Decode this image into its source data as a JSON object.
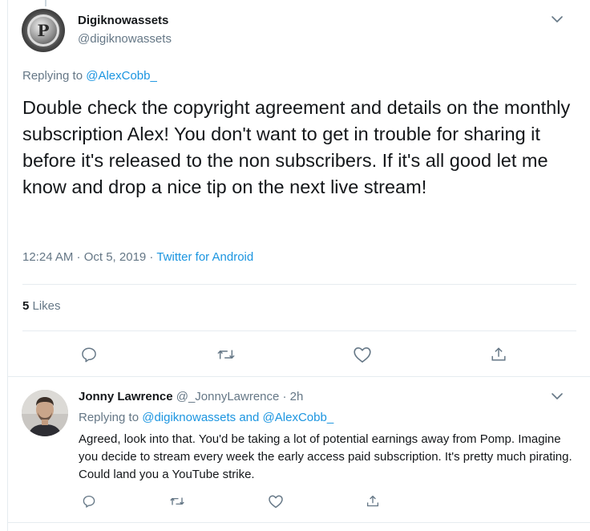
{
  "main_tweet": {
    "author_name": "Digiknowassets",
    "author_handle": "@digiknowassets",
    "replying_prefix": "Replying to",
    "replying_to": "@AlexCobb_",
    "text": "Double check the copyright agreement and details on the monthly subscription Alex! You don't want to get in trouble for sharing it before it's released to the non subscribers. If it's all good let me know and drop a nice tip on the next live stream!",
    "timestamp": "12:24 AM · Oct 5, 2019 · ",
    "source": "Twitter for Android",
    "likes_count": "5",
    "likes_label": " Likes",
    "avatar_letter": "P"
  },
  "reply_tweet": {
    "author_name": "Jonny Lawrence",
    "meta": "@_JonnyLawrence · 2h",
    "replying_prefix": "Replying to",
    "replying_user1": "@digiknowassets",
    "replying_and": "and",
    "replying_user2": "@AlexCobb_",
    "text": "Agreed, look into that. You'd be taking a lot of potential earnings away from Pomp. Imagine you decide to stream every week the early access paid subscription. It's pretty much pirating. Could land you a YouTube strike."
  },
  "colors": {
    "link": "#1b95e0",
    "secondary_text": "#657786",
    "primary_text": "#14171a",
    "divider": "#e6ecf0"
  },
  "icons": [
    "chevron-down-icon",
    "reply-icon",
    "retweet-icon",
    "like-icon",
    "share-icon"
  ]
}
